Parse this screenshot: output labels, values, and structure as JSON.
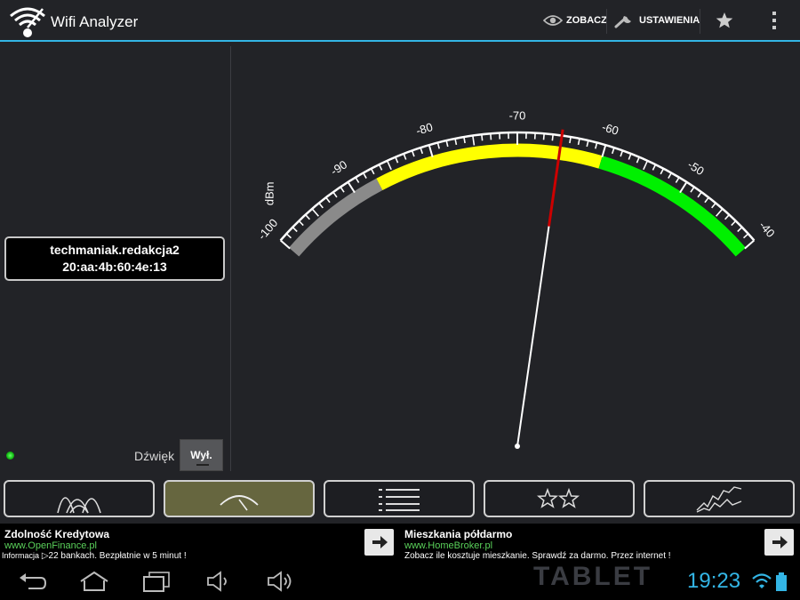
{
  "app": {
    "title": "Wifi Analyzer"
  },
  "actionbar": {
    "view_label": "ZOBACZ",
    "settings_label": "USTAWIENIA"
  },
  "network": {
    "ssid": "techmaniak.redakcja2",
    "bssid": "20:aa:4b:60:4e:13"
  },
  "sound": {
    "label": "Dźwięk",
    "toggle_value": "Wył."
  },
  "gauge": {
    "unit": "dBm",
    "min": -100,
    "max": -40,
    "tick_labels": [
      "-100",
      "-90",
      "-80",
      "-70",
      "-60",
      "-50",
      "-40"
    ],
    "needle_value": -65,
    "zones": [
      {
        "from": -100,
        "to": -87,
        "color": "#8a8a8a"
      },
      {
        "from": -87,
        "to": -60,
        "color": "#ffff00"
      },
      {
        "from": -60,
        "to": -40,
        "color": "#00f000"
      }
    ],
    "needle_color": "#cc0000"
  },
  "tabs": [
    {
      "name": "channel-graph",
      "active": false
    },
    {
      "name": "signal-meter",
      "active": true
    },
    {
      "name": "ap-list",
      "active": false
    },
    {
      "name": "channel-rating",
      "active": false
    },
    {
      "name": "time-graph",
      "active": false
    }
  ],
  "ads": [
    {
      "title": "Zdolność Kredytowa",
      "url": "www.OpenFinance.pl",
      "info": "Informacja",
      "desc": "22 bankach. Bezpłatnie w 5 minut !"
    },
    {
      "title": "Mieszkania półdarmo",
      "url": "www.HomeBroker.pl",
      "desc": "Zobacz ile kosztuje mieszkanie. Sprawdź za darmo. Przez internet !"
    }
  ],
  "statusbar": {
    "time": "19:23",
    "watermark": "TABLET"
  },
  "colors": {
    "accent": "#33b5e5",
    "active_tab": "#66663f"
  }
}
